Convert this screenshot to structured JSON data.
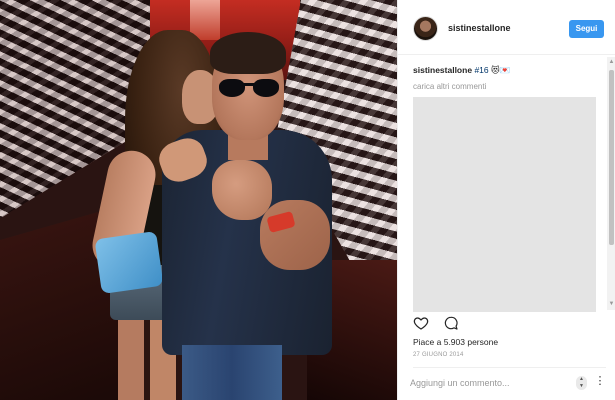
{
  "post": {
    "photo_alt_icon": "photo",
    "header": {
      "username": "sistinestallone",
      "follow_label": "Segui"
    },
    "caption": {
      "username": "sistinestallone",
      "text": "#16",
      "emoji": "😻💌"
    },
    "load_more_label": "carica altri commenti",
    "actions": {
      "like_icon": "heart-icon",
      "comment_icon": "comment-icon"
    },
    "likes_text": "Piace a 5.903 persone",
    "date_text": "27 GIUGNO 2014",
    "comment_input": {
      "placeholder": "Aggiungi un commento...",
      "value": ""
    },
    "more_label": "⋮",
    "colors": {
      "accent": "#3897f0",
      "text": "#262626",
      "muted": "#999999",
      "hashtag": "#003569"
    }
  }
}
